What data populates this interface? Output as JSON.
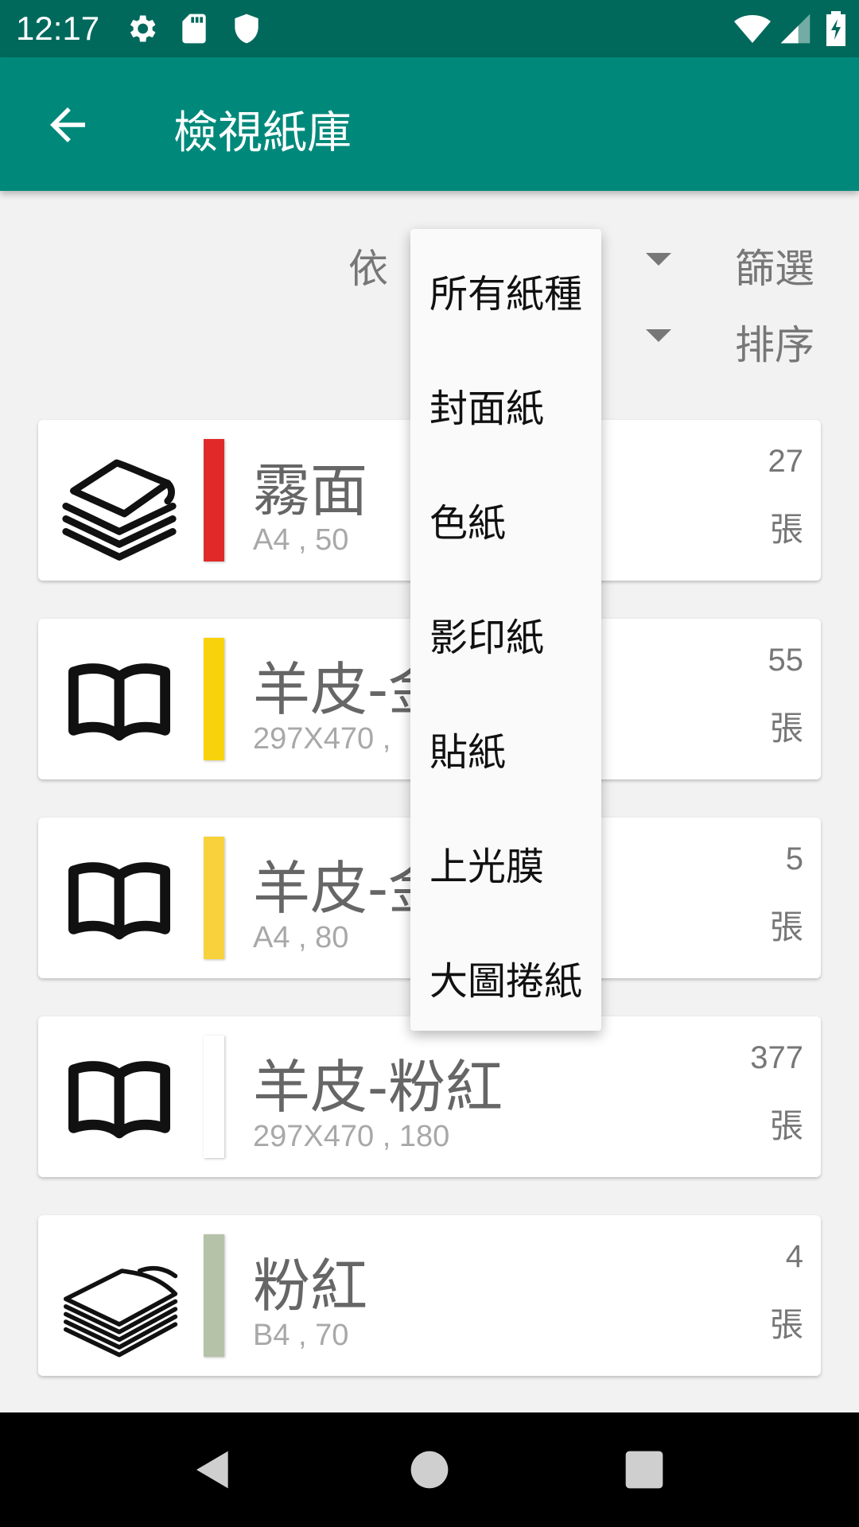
{
  "status_bar": {
    "time": "12:17",
    "icons": [
      "settings-icon",
      "sd-card-icon",
      "shield-icon",
      "wifi-icon",
      "signal-icon",
      "battery-icon"
    ]
  },
  "app_bar": {
    "title": "檢視紙庫",
    "back_icon": "arrow-back-icon",
    "background": "#00897b",
    "status_background": "#00695c"
  },
  "filters": {
    "by_label": "依",
    "filter_label": "篩選",
    "sort_label": "排序"
  },
  "dropdown": {
    "options": [
      "所有紙種",
      "封面紙",
      "色紙",
      "影印紙",
      "貼紙",
      "上光膜",
      "大圖捲紙"
    ]
  },
  "papers": [
    {
      "name": "霧面",
      "spec": "A4 , 50",
      "count": "27",
      "unit": "張",
      "color": "#e02a2a",
      "icon": "paper-stack-icon"
    },
    {
      "name": "羊皮-金",
      "spec": "297X470 ,",
      "count": "55",
      "unit": "張",
      "color": "#f8d20c",
      "icon": "open-book-icon"
    },
    {
      "name": "羊皮-金",
      "spec": "A4 , 80",
      "count": "5",
      "unit": "張",
      "color": "#f8d23c",
      "icon": "open-book-icon"
    },
    {
      "name": "羊皮-粉紅",
      "spec": "297X470 , 180",
      "count": "377",
      "unit": "張",
      "color": "#ffffff",
      "icon": "open-book-icon"
    },
    {
      "name": "粉紅",
      "spec": "B4 , 70",
      "count": "4",
      "unit": "張",
      "color": "#b5c2a8",
      "icon": "flat-paper-stack-icon"
    }
  ],
  "nav_bar": {
    "icons": [
      "back-nav-icon",
      "home-nav-icon",
      "recents-nav-icon"
    ]
  }
}
